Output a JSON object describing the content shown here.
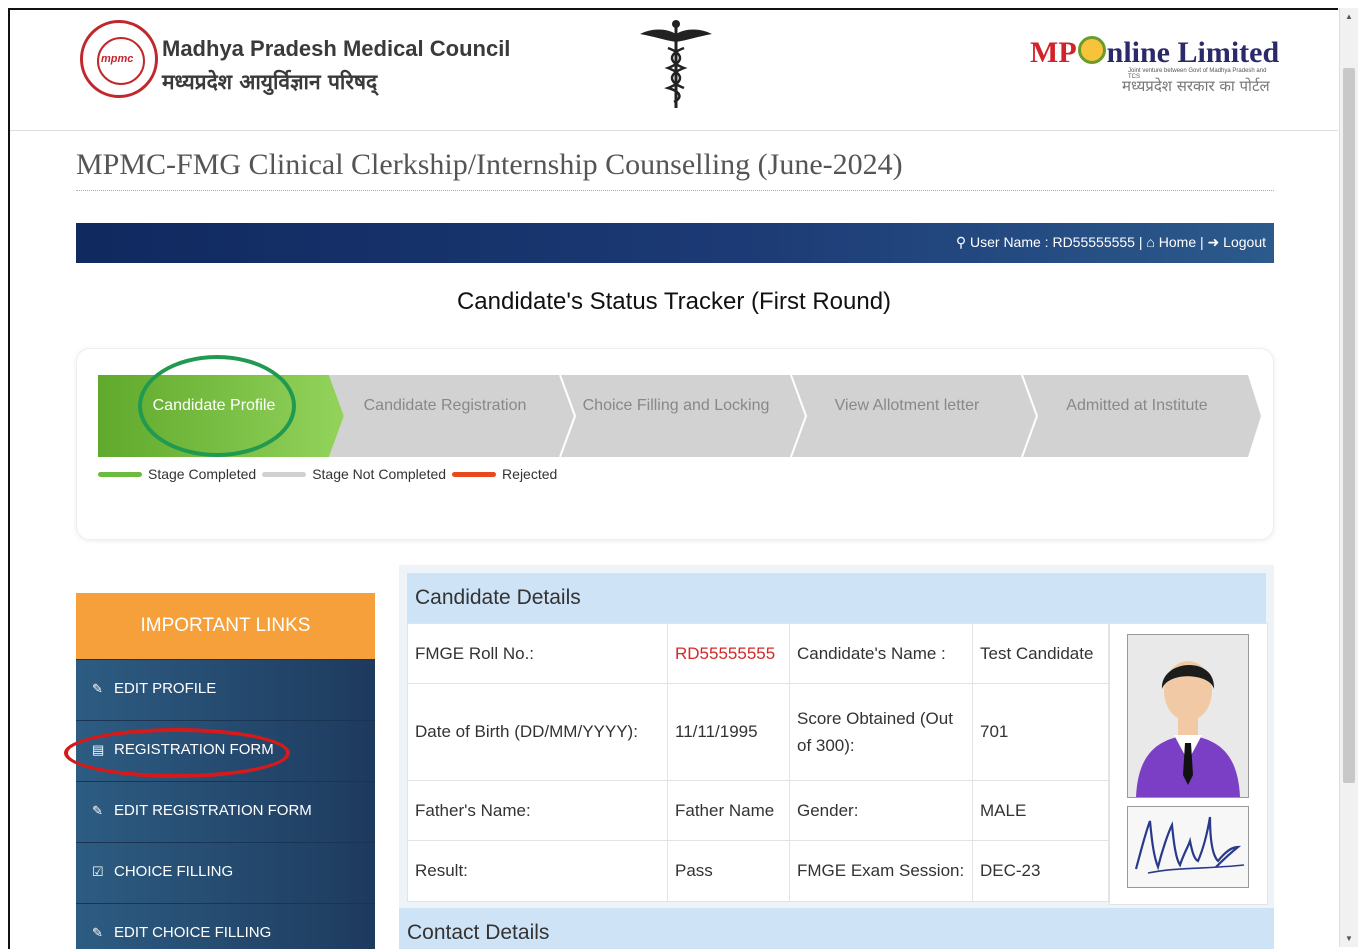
{
  "header": {
    "org_name_en": "Madhya Pradesh Medical Council",
    "org_name_hi": "मध्यप्रदेश आयुर्विज्ञान परिषद्",
    "seal_text": "mpmc",
    "mponline_brand_mp": "MP",
    "mponline_brand_rest": "nline Limited",
    "mponline_tagline": "Joint venture between Govt of Madhya Pradesh and TCS",
    "mponline_hi": "मध्यप्रदेश सरकार का पोर्टल"
  },
  "page_title": "MPMC-FMG Clinical Clerkship/Internship Counselling (June-2024)",
  "userbar": {
    "user_label": "User Name : RD55555555",
    "home_label": "Home",
    "logout_label": "Logout"
  },
  "tracker": {
    "title": "Candidate's Status Tracker (First Round)",
    "steps": [
      {
        "label": "Candidate Profile",
        "status": "completed"
      },
      {
        "label": "Candidate Registration",
        "status": "not-completed"
      },
      {
        "label": "Choice Filling and Locking",
        "status": "not-completed"
      },
      {
        "label": "View Allotment letter",
        "status": "not-completed"
      },
      {
        "label": "Admitted at Institute",
        "status": "not-completed"
      }
    ],
    "legend": {
      "completed": "Stage Completed",
      "not_completed": "Stage Not Completed",
      "rejected": "Rejected"
    },
    "colors": {
      "completed": "#6dbb3f",
      "not_completed": "#d0d0d0",
      "rejected": "#e8491d"
    }
  },
  "important_links": {
    "title": "IMPORTANT LINKS",
    "items": [
      {
        "label": "EDIT PROFILE",
        "icon": "edit-icon"
      },
      {
        "label": "REGISTRATION FORM",
        "icon": "id-card-icon"
      },
      {
        "label": "EDIT REGISTRATION FORM",
        "icon": "edit-icon"
      },
      {
        "label": "CHOICE FILLING",
        "icon": "checkbox-icon"
      },
      {
        "label": "EDIT CHOICE FILLING",
        "icon": "edit-icon"
      }
    ]
  },
  "candidate_details": {
    "title": "Candidate Details",
    "roll_label": "FMGE Roll No.:",
    "roll_value": "RD55555555",
    "name_label": "Candidate's Name :",
    "name_value": "Test Candidate",
    "dob_label": "Date of Birth (DD/MM/YYYY):",
    "dob_value": "11/11/1995",
    "score_label": "Score Obtained (Out of 300):",
    "score_value": "701",
    "father_label": "Father's Name:",
    "father_value": "Father Name",
    "gender_label": "Gender:",
    "gender_value": "MALE",
    "result_label": "Result:",
    "result_value": "Pass",
    "session_label": "FMGE Exam Session:",
    "session_value": "DEC-23"
  },
  "contact_details": {
    "title": "Contact Details"
  }
}
